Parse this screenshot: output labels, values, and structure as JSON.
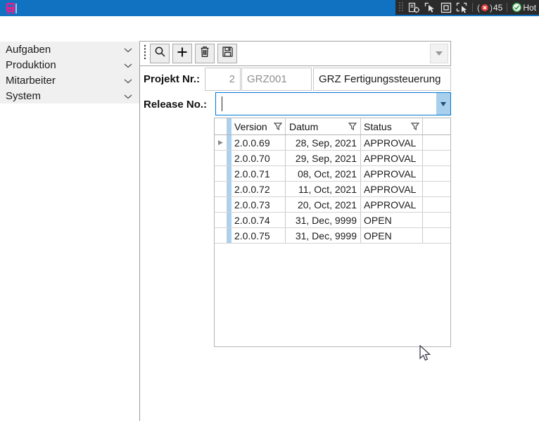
{
  "colors": {
    "titlebar_blue": "#1272c2",
    "app_icon_pink": "#e91e8c",
    "combobox_focus_blue": "#0078d7",
    "grid_stripe_blue": "#a9d2f1",
    "tray_badge_red": "#e23b3b",
    "tray_check_green": "#2e9e44"
  },
  "tray": {
    "session_count": "45",
    "hot_label": "Hot",
    "icons": [
      "script-target-icon",
      "pointer-frame-icon",
      "center-square-icon",
      "selection-pointer-icon",
      "connection-badge-icon",
      "status-check-icon"
    ]
  },
  "sidebar": {
    "items": [
      {
        "label": "Aufgaben"
      },
      {
        "label": "Produktion"
      },
      {
        "label": "Mitarbeiter"
      },
      {
        "label": "System"
      }
    ]
  },
  "toolbar": {
    "buttons": [
      {
        "name": "search"
      },
      {
        "name": "add"
      },
      {
        "name": "delete"
      },
      {
        "name": "save"
      }
    ]
  },
  "project": {
    "label": "Projekt Nr.:",
    "number": "2",
    "code": "GRZ001",
    "name": "GRZ Fertigungssteuerung"
  },
  "release": {
    "label": "Release No.:",
    "value": ""
  },
  "grid": {
    "columns": [
      {
        "label": "Version"
      },
      {
        "label": "Datum"
      },
      {
        "label": "Status"
      }
    ],
    "rows": [
      {
        "version": "2.0.0.69",
        "datum": "28, Sep, 2021",
        "status": "APPROVAL"
      },
      {
        "version": "2.0.0.70",
        "datum": "29, Sep, 2021",
        "status": "APPROVAL"
      },
      {
        "version": "2.0.0.71",
        "datum": "08, Oct, 2021",
        "status": "APPROVAL"
      },
      {
        "version": "2.0.0.72",
        "datum": "11, Oct, 2021",
        "status": "APPROVAL"
      },
      {
        "version": "2.0.0.73",
        "datum": "20, Oct, 2021",
        "status": "APPROVAL"
      },
      {
        "version": "2.0.0.74",
        "datum": "31, Dec, 9999",
        "status": "OPEN"
      },
      {
        "version": "2.0.0.75",
        "datum": "31, Dec, 9999",
        "status": "OPEN"
      }
    ]
  }
}
